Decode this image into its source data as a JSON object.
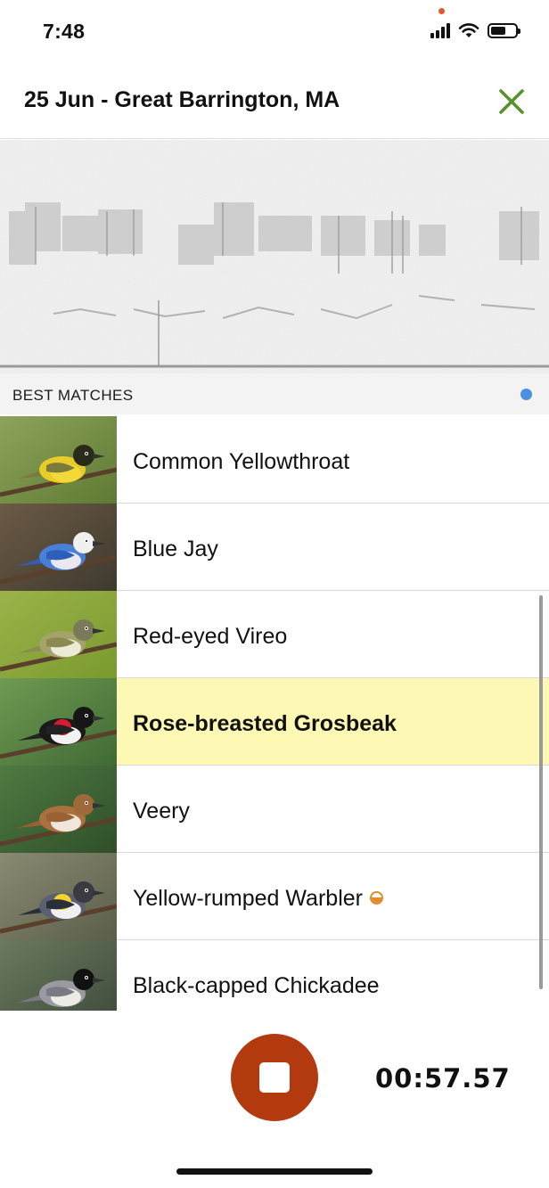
{
  "status_bar": {
    "time": "7:48",
    "privacy_dot_color": "#e05a2b"
  },
  "header": {
    "title": "25 Jun - Great Barrington, MA",
    "close_icon": "close-x-icon",
    "accent_color": "#5a8f2f"
  },
  "spectrogram": {
    "icon": "spectrogram-image"
  },
  "matches": {
    "section_label": "BEST MATCHES",
    "live_dot_color": "#4a8fe0",
    "highlight_color": "#fdf9b4",
    "items": [
      {
        "name": "Common Yellowthroat",
        "highlighted": false,
        "badge": false,
        "image": "common-yellowthroat-photo"
      },
      {
        "name": "Blue Jay",
        "highlighted": false,
        "badge": false,
        "image": "blue-jay-photo"
      },
      {
        "name": "Red-eyed Vireo",
        "highlighted": false,
        "badge": false,
        "image": "red-eyed-vireo-photo"
      },
      {
        "name": "Rose-breasted Grosbeak",
        "highlighted": true,
        "badge": false,
        "image": "rose-breasted-grosbeak-photo"
      },
      {
        "name": "Veery",
        "highlighted": false,
        "badge": false,
        "image": "veery-photo"
      },
      {
        "name": "Yellow-rumped Warbler",
        "highlighted": false,
        "badge": true,
        "image": "yellow-rumped-warbler-photo"
      },
      {
        "name": "Black-capped Chickadee",
        "highlighted": false,
        "badge": false,
        "image": "black-capped-chickadee-photo"
      }
    ]
  },
  "recorder": {
    "elapsed": "00:57.57",
    "stop_button_color": "#b23a0e",
    "stop_icon": "stop-square-icon"
  }
}
